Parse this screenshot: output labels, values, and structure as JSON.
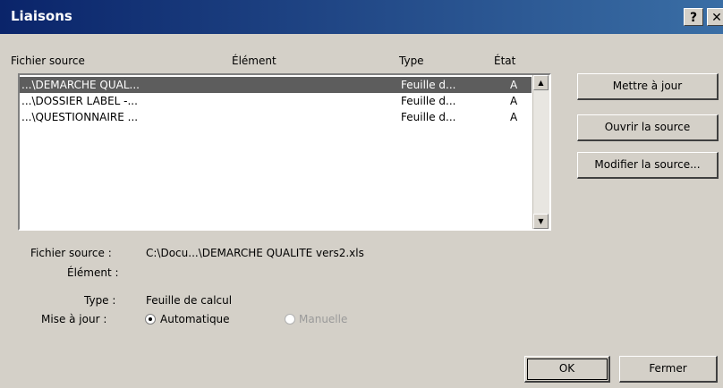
{
  "window": {
    "title": "Liaisons",
    "help_button": "?",
    "close_button": "✕"
  },
  "columns": {
    "file": "Fichier source",
    "element": "Élément",
    "type": "Type",
    "state": "État"
  },
  "links": [
    {
      "file": "...\\DEMARCHE QUAL...",
      "type": "Feuille d...",
      "state": "A",
      "selected": true
    },
    {
      "file": "...\\DOSSIER LABEL -...",
      "type": "Feuille d...",
      "state": "A",
      "selected": false
    },
    {
      "file": "...\\QUESTIONNAIRE ...",
      "type": "Feuille d...",
      "state": "A",
      "selected": false
    }
  ],
  "buttons": {
    "update": "Mettre à jour",
    "open_source": "Ouvrir la source",
    "change_source": "Modifier la source...",
    "ok": "OK",
    "close": "Fermer"
  },
  "details": {
    "file_label": "Fichier source :",
    "file_value": "C:\\Docu...\\DEMARCHE QUALITE vers2.xls",
    "element_label": "Élément :",
    "element_value": "",
    "type_label": "Type :",
    "type_value": "Feuille de calcul",
    "update_label": "Mise à jour :",
    "option_auto": "Automatique",
    "option_manual": "Manuelle",
    "selected_option": "auto"
  },
  "icons": {
    "help": "help-icon",
    "close": "close-icon",
    "scroll_up": "scroll-up-arrow-icon",
    "scroll_down": "scroll-down-arrow-icon"
  },
  "colors": {
    "title_bar_start": "#0a246a",
    "title_bar_end": "#3a6ea5",
    "dialog_bg": "#d4d0c8",
    "selection_bg": "#5d5d5d"
  }
}
